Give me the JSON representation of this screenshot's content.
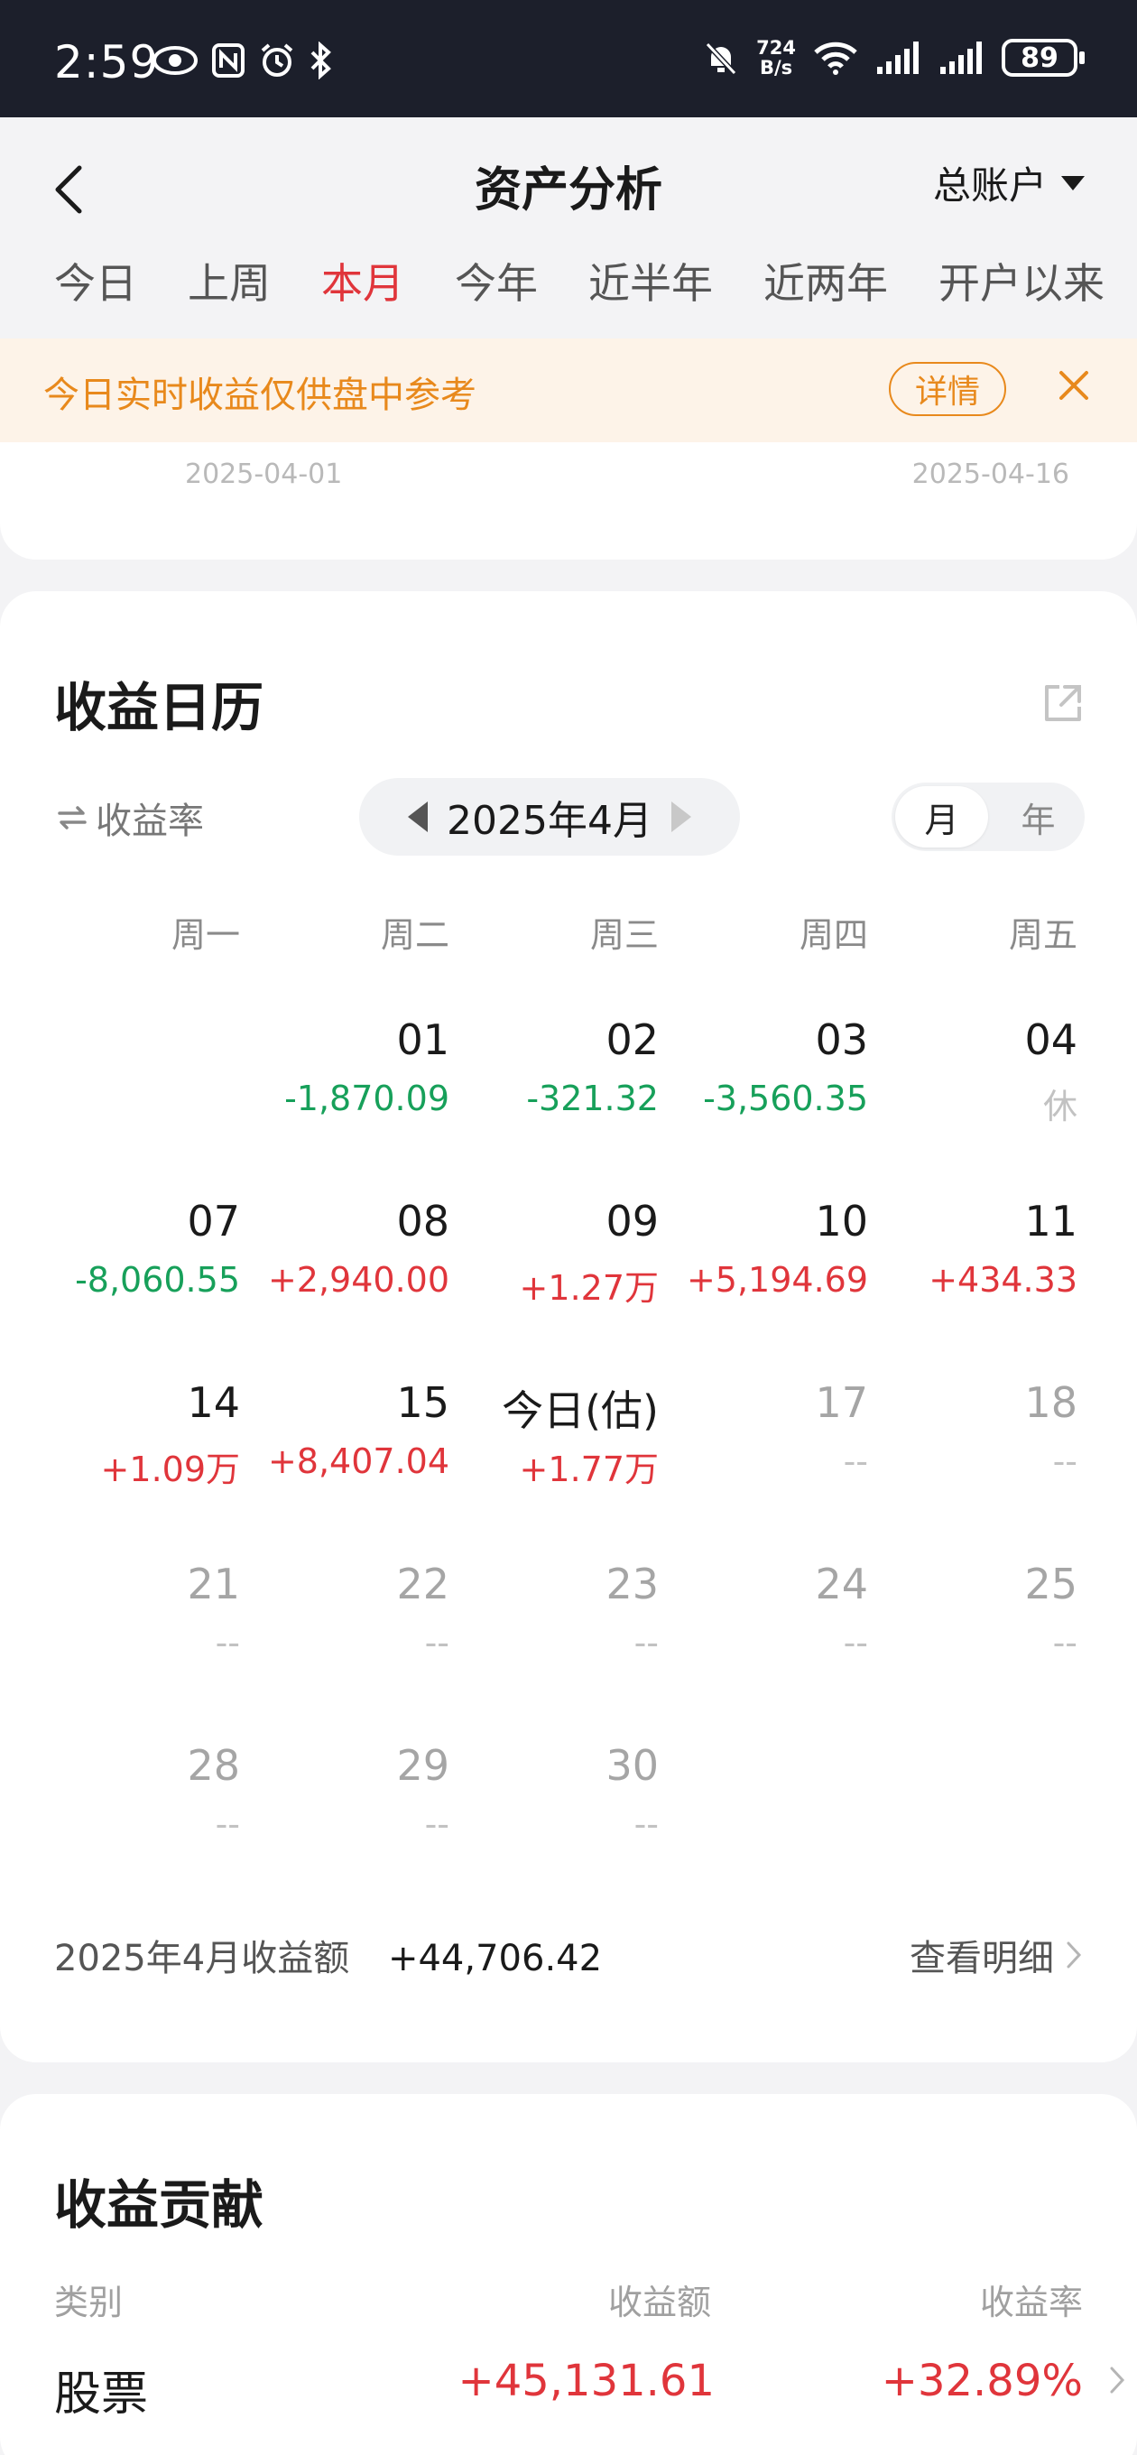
{
  "status_bar": {
    "time": "2:59",
    "net_speed_value": "724",
    "net_speed_unit": "B/s",
    "battery": "89",
    "icons": [
      "eye-icon",
      "nfc-icon",
      "alarm-icon",
      "bluetooth-icon",
      "mute-icon",
      "wifi-icon",
      "signal-icon",
      "signal-icon"
    ]
  },
  "header": {
    "title": "资产分析",
    "account": "总账户",
    "tabs": [
      "今日",
      "上周",
      "本月",
      "今年",
      "近半年",
      "近两年",
      "开户以来"
    ],
    "active_tab": "本月"
  },
  "notice": {
    "text": "今日实时收益仅供盘中参考",
    "button": "详情"
  },
  "chart_remnant": {
    "start_date": "2025-04-01",
    "end_date": "2025-04-16"
  },
  "calendar": {
    "title": "收益日历",
    "rate_toggle": "收益率",
    "month": "2025年4月",
    "view_options": [
      "月",
      "年"
    ],
    "active_view": "月",
    "weekdays": [
      "周一",
      "周二",
      "周三",
      "周四",
      "周五"
    ],
    "weeks": [
      [
        {
          "day": "",
          "value": "",
          "tone": "none"
        },
        {
          "day": "01",
          "value": "-1,870.09",
          "tone": "loss"
        },
        {
          "day": "02",
          "value": "-321.32",
          "tone": "loss"
        },
        {
          "day": "03",
          "value": "-3,560.35",
          "tone": "loss"
        },
        {
          "day": "04",
          "value": "休",
          "tone": "rest"
        }
      ],
      [
        {
          "day": "07",
          "value": "-8,060.55",
          "tone": "loss"
        },
        {
          "day": "08",
          "value": "+2,940.00",
          "tone": "gain"
        },
        {
          "day": "09",
          "value": "+1.27万",
          "tone": "gain"
        },
        {
          "day": "10",
          "value": "+5,194.69",
          "tone": "gain"
        },
        {
          "day": "11",
          "value": "+434.33",
          "tone": "gain"
        }
      ],
      [
        {
          "day": "14",
          "value": "+1.09万",
          "tone": "gain"
        },
        {
          "day": "15",
          "value": "+8,407.04",
          "tone": "gain"
        },
        {
          "day": "今日(估)",
          "value": "+1.77万",
          "tone": "gain"
        },
        {
          "day": "17",
          "value": "--",
          "tone": "future"
        },
        {
          "day": "18",
          "value": "--",
          "tone": "future"
        }
      ],
      [
        {
          "day": "21",
          "value": "--",
          "tone": "future"
        },
        {
          "day": "22",
          "value": "--",
          "tone": "future"
        },
        {
          "day": "23",
          "value": "--",
          "tone": "future"
        },
        {
          "day": "24",
          "value": "--",
          "tone": "future"
        },
        {
          "day": "25",
          "value": "--",
          "tone": "future"
        }
      ],
      [
        {
          "day": "28",
          "value": "--",
          "tone": "future"
        },
        {
          "day": "29",
          "value": "--",
          "tone": "future"
        },
        {
          "day": "30",
          "value": "--",
          "tone": "future"
        },
        {
          "day": "",
          "value": "",
          "tone": "none"
        },
        {
          "day": "",
          "value": "",
          "tone": "none"
        }
      ]
    ],
    "summary_label": "2025年4月收益额",
    "summary_value": "+44,706.42",
    "detail_link": "查看明细"
  },
  "contribution": {
    "title": "收益贡献",
    "headers": [
      "类别",
      "收益额",
      "收益率"
    ],
    "rows": [
      {
        "category": "股票",
        "amount": "+45,131.61",
        "rate": "+32.89%"
      }
    ]
  },
  "colors": {
    "gain": "#e0353b",
    "loss": "#17a05a",
    "accent": "#e0353b",
    "notice": "#e8891c"
  }
}
